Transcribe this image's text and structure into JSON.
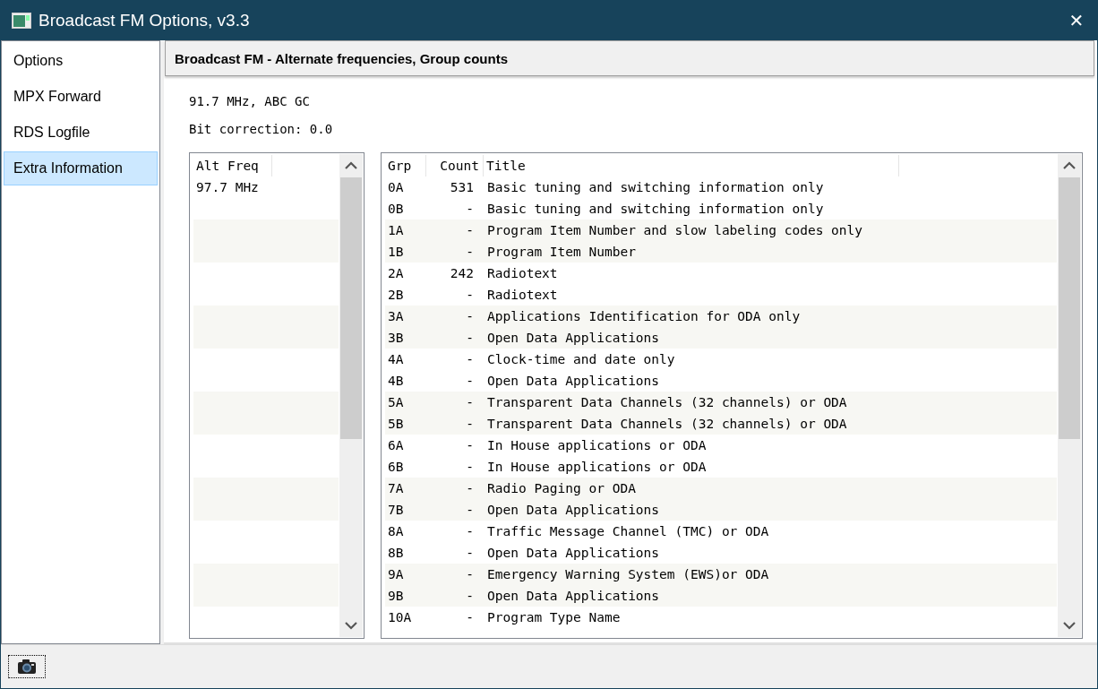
{
  "window": {
    "title": "Broadcast FM Options, v3.3",
    "close": "✕"
  },
  "sidebar": {
    "items": [
      {
        "label": "Options",
        "selected": false
      },
      {
        "label": "MPX Forward",
        "selected": false
      },
      {
        "label": "RDS Logfile",
        "selected": false
      },
      {
        "label": "Extra Information",
        "selected": true
      }
    ]
  },
  "panel": {
    "header": "Broadcast FM - Alternate frequencies, Group counts",
    "station": "91.7 MHz, ABC GC",
    "bit_correction": "Bit correction: 0.0"
  },
  "alt_freq": {
    "columns": [
      "Alt Freq"
    ],
    "rows": [
      "97.7 MHz"
    ]
  },
  "groups": {
    "columns": [
      "Grp",
      "Count",
      "Title"
    ],
    "rows": [
      [
        "0A",
        "531",
        "Basic tuning and switching information only"
      ],
      [
        "0B",
        "-",
        "Basic tuning and switching information only"
      ],
      [
        "1A",
        "-",
        "Program Item Number and slow labeling codes only"
      ],
      [
        "1B",
        "-",
        "Program Item Number"
      ],
      [
        "2A",
        "242",
        "Radiotext"
      ],
      [
        "2B",
        "-",
        "Radiotext"
      ],
      [
        "3A",
        "-",
        "Applications Identification for ODA only"
      ],
      [
        "3B",
        "-",
        "Open Data Applications"
      ],
      [
        "4A",
        "-",
        "Clock-time and date only"
      ],
      [
        "4B",
        "-",
        "Open Data Applications"
      ],
      [
        "5A",
        "-",
        "Transparent Data Channels (32 channels) or ODA"
      ],
      [
        "5B",
        "-",
        "Transparent Data Channels (32 channels) or ODA"
      ],
      [
        "6A",
        "-",
        "In House applications or ODA"
      ],
      [
        "6B",
        "-",
        "In House applications or ODA"
      ],
      [
        "7A",
        "-",
        "Radio Paging or ODA"
      ],
      [
        "7B",
        "-",
        "Open Data Applications"
      ],
      [
        "8A",
        "-",
        "Traffic Message Channel (TMC) or ODA"
      ],
      [
        "8B",
        "-",
        "Open Data Applications"
      ],
      [
        "9A",
        "-",
        "Emergency Warning System (EWS)or ODA"
      ],
      [
        "9B",
        "-",
        "Open Data Applications"
      ],
      [
        "10A",
        "-",
        "Program Type Name"
      ]
    ]
  }
}
